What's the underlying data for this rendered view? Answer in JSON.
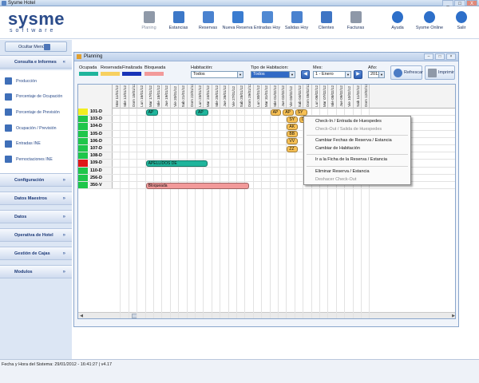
{
  "window": {
    "title": "Sysme Hotel",
    "buttons": [
      "_",
      "□",
      "X"
    ]
  },
  "logo": {
    "name": "sysme",
    "tagline": "software"
  },
  "toolbar": {
    "items": [
      {
        "label": "Planing",
        "icon": "planning-icon",
        "color": "#8f99a8",
        "disabled": true
      },
      {
        "label": "Estancias",
        "icon": "stays-icon",
        "color": "#3d78c8",
        "disabled": false
      },
      {
        "label": "Reservas",
        "icon": "reservations-icon",
        "color": "#4a82cf",
        "disabled": false
      },
      {
        "label": "Nueva Reserva",
        "icon": "new-reservation-icon",
        "color": "#3a7cd0",
        "disabled": false
      },
      {
        "label": "Entradas Hoy",
        "icon": "checkin-today-icon",
        "color": "#5089d3",
        "disabled": false
      },
      {
        "label": "Salidas Hoy",
        "icon": "checkout-today-icon",
        "color": "#4a82cf",
        "disabled": false
      },
      {
        "label": "Clientes",
        "icon": "clients-icon",
        "color": "#3f75c4",
        "disabled": false
      },
      {
        "label": "Facturas",
        "icon": "invoices-icon",
        "color": "#8e98a8",
        "disabled": false
      }
    ],
    "right_items": [
      {
        "label": "Ayuda",
        "icon": "help-icon",
        "color": "#2d6fc9"
      },
      {
        "label": "Sysme Online",
        "icon": "online-icon",
        "color": "#2d6fc9"
      },
      {
        "label": "Salir",
        "icon": "exit-icon",
        "color": "#2d6fc9"
      }
    ]
  },
  "sidebar": {
    "hide_menu_label": "Ocultar Menú",
    "open_section": {
      "label": "Consulta e Informes",
      "items": [
        {
          "label": "Producción"
        },
        {
          "label": "Porcentaje de Ocupación"
        },
        {
          "label": "Porcentaje de Previsión"
        },
        {
          "label": "Ocupación / Previsión"
        },
        {
          "label": "Entradas INE"
        },
        {
          "label": "Pernoctaciones INE"
        }
      ]
    },
    "sections": [
      {
        "label": "Configuración"
      },
      {
        "label": "Datos Maestros"
      },
      {
        "label": "Datos"
      },
      {
        "label": "Operativa de Hotel"
      },
      {
        "label": "Gestión de Cajas"
      },
      {
        "label": "Modulos"
      }
    ]
  },
  "planning": {
    "title": "Planning",
    "legend": [
      {
        "label": "Ocupada",
        "color": "#1fb59c"
      },
      {
        "label": "Reservada",
        "color": "#f7d060"
      },
      {
        "label": "Finalizada",
        "color": "#1733b8"
      },
      {
        "label": "Bloqueada",
        "color": "#f29a9a"
      }
    ],
    "filters": {
      "habitacion_label": "Habitación:",
      "habitacion_value": "Todos",
      "tipo_label": "Tipo de Habitacion:",
      "tipo_value": "Todos",
      "mes_label": "Mes:",
      "mes_value": "1 - Enero",
      "ano_label": "Año:",
      "ano_value": "2012"
    },
    "refresh_label": "Refrescar",
    "print_label": "Imprimir",
    "columns": [
      "Mar 11/01/12",
      "Mie 12/01/12",
      "Dom 15/01/12",
      "Lun 16/01/12",
      "Mar 17/01/12",
      "Mie 18/01/12",
      "Jue 19/01/12",
      "Vie 20/01/12",
      "Sab 21/01/12",
      "Dom 22/01/12",
      "Lun 23/01/12",
      "Mar 24/01/12",
      "Mie 25/01/12",
      "Jue 26/01/12",
      "Vie 27/01/12",
      "Sab 28/01/12",
      "Dom 29/01/12",
      "Lun 30/01/12",
      "Mar 31/01/12",
      "Mie 01/02/12",
      "Jue 02/02/12",
      "Vie 03/02/12",
      "Sab 04/02/12",
      "Dom 05/02/12",
      "Lun 06/02/12",
      "Mar 07/02/12",
      "Mie 08/02/12",
      "Jue 09/02/12",
      "Vie 10/02/12",
      "Sab 11/02/12",
      "Dom 12/02/12"
    ],
    "rooms": [
      {
        "label": "101-D",
        "status_color": "#f2ee20"
      },
      {
        "label": "103-D",
        "status_color": "#1fc64a"
      },
      {
        "label": "104-D",
        "status_color": "#1fc64a"
      },
      {
        "label": "105-D",
        "status_color": "#1fc64a"
      },
      {
        "label": "106-D",
        "status_color": "#1fc64a"
      },
      {
        "label": "107-D",
        "status_color": "#1fc64a"
      },
      {
        "label": "108-D",
        "status_color": "#1fc64a"
      },
      {
        "label": "109-D",
        "status_color": "#e01818"
      },
      {
        "label": "110-D",
        "status_color": "#1fc64a"
      },
      {
        "label": "256-D",
        "status_color": "#1fc64a"
      },
      {
        "label": "350-V",
        "status_color": "#1fc64a"
      }
    ],
    "bookings": [
      {
        "row": 0,
        "start": 4,
        "len": 1.6,
        "label": "AP",
        "color": "#1fb59c"
      },
      {
        "row": 0,
        "start": 10,
        "len": 1.6,
        "label": "AP",
        "color": "#1fb59c"
      },
      {
        "row": 0,
        "start": 19,
        "len": 1.4,
        "label": "AP",
        "color": "#f7c054"
      },
      {
        "row": 0,
        "start": 20.5,
        "len": 1.4,
        "label": "AP",
        "color": "#f7c054"
      },
      {
        "row": 0,
        "start": 22,
        "len": 1.6,
        "label": "SY",
        "color": "#f7c054"
      },
      {
        "row": 1,
        "start": 21,
        "len": 1.4,
        "label": "SY",
        "color": "#f7c054"
      },
      {
        "row": 1,
        "start": 22.5,
        "len": 5.5,
        "label": "DE E SALS...",
        "color": "#f7c054"
      },
      {
        "row": 2,
        "start": 21,
        "len": 1.4,
        "label": "AK",
        "color": "#f7c054"
      },
      {
        "row": 3,
        "start": 21,
        "len": 1.4,
        "label": "BB",
        "color": "#f7c054"
      },
      {
        "row": 4,
        "start": 21,
        "len": 1.4,
        "label": "VV",
        "color": "#f7c054"
      },
      {
        "row": 5,
        "start": 21,
        "len": 1.4,
        "label": "ZZ",
        "color": "#f7c054"
      },
      {
        "row": 7,
        "start": 4,
        "len": 7.5,
        "label": "APELLIDOS DE",
        "color": "#1fb59c"
      },
      {
        "row": 10,
        "start": 4,
        "len": 12.5,
        "label": "Bloqueada",
        "color": "#f29a9a"
      }
    ]
  },
  "context_menu": {
    "items": [
      {
        "label": "Check-In / Entrada de Huespedes",
        "disabled": false
      },
      {
        "label": "Check-Out / Salida de Huespedes",
        "disabled": true
      },
      {
        "sep": true
      },
      {
        "label": "Cambiar Fechas de Reserva / Estancia",
        "disabled": false
      },
      {
        "label": "Cambiar de Habitación",
        "disabled": false
      },
      {
        "sep": true
      },
      {
        "label": "Ir a la Ficha de la Reserva / Estancia",
        "disabled": false
      },
      {
        "sep": true
      },
      {
        "label": "Eliminar Reserva / Estancia",
        "disabled": false
      },
      {
        "label": "Deshacer Check-Out",
        "disabled": true
      }
    ]
  },
  "status": {
    "text": "Fecha y Hora del Sistema: 29/01/2012 - 16:41:27 | v4.17"
  }
}
